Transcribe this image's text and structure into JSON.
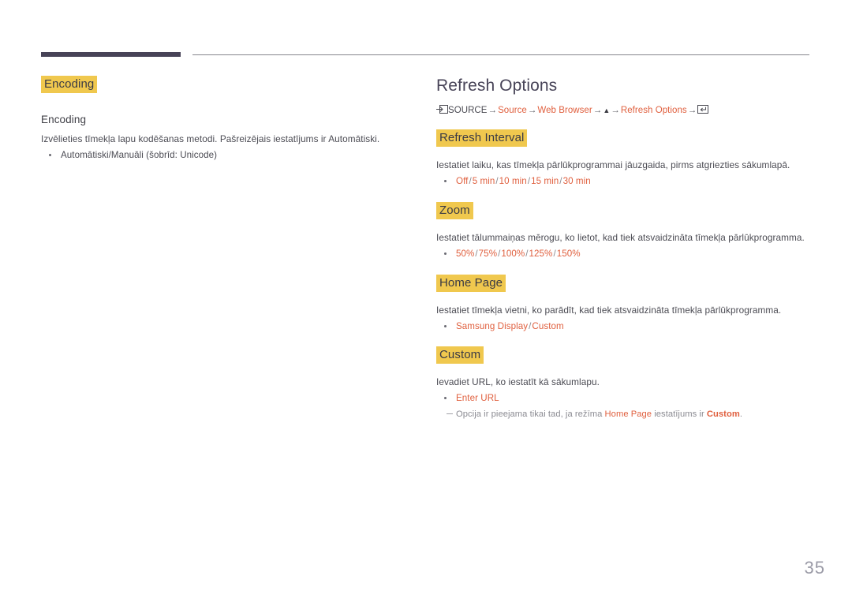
{
  "colors": {
    "highlight": "#f0c84e",
    "accent": "#e0603f",
    "heading": "#474357",
    "body": "#4b4b53",
    "rule_dark": "#474357",
    "rule_light": "#86868c",
    "page_number": "#9a9aa6"
  },
  "left_column": {
    "highlight_heading": "Encoding",
    "sub_heading": "Encoding",
    "description": "Izvēlieties tīmekļa lapu kodēšanas metodi. Pašreizējais iestatījums ir Automātiski.",
    "bullets": [
      {
        "text": "Automātiski/Manuāli (šobrīd: Unicode)",
        "style": "plain"
      }
    ]
  },
  "right_column": {
    "page_heading": "Refresh Options",
    "breadcrumb": {
      "source_icon": "source-input-icon",
      "source_label": "SOURCE",
      "items": [
        {
          "label": "Source",
          "type": "link"
        },
        {
          "label": "Web Browser",
          "type": "link"
        },
        {
          "label": "▲",
          "type": "up-triangle-icon"
        },
        {
          "label": "Refresh Options",
          "type": "link"
        }
      ],
      "arrow": "→",
      "enter_icon": "enter-key-icon"
    },
    "sections": [
      {
        "title": "Refresh Interval",
        "description": "Iestatiet laiku, kas tīmekļa pārlūkprogrammai jāuzgaida, pirms atgriezties sākumlapā.",
        "options": [
          "Off",
          "5 min",
          "10 min",
          "15 min",
          "30 min"
        ],
        "separator": "/"
      },
      {
        "title": "Zoom",
        "description": "Iestatiet tālummaiņas mērogu, ko lietot, kad tiek atsvaidzināta tīmekļa pārlūkprogramma.",
        "options": [
          "50%",
          "75%",
          "100%",
          "125%",
          "150%"
        ],
        "separator": "/"
      },
      {
        "title": "Home Page",
        "description": "Iestatiet tīmekļa vietni, ko parādīt, kad tiek atsvaidzināta tīmekļa pārlūkprogramma.",
        "options": [
          "Samsung Display",
          "Custom"
        ],
        "separator": "/"
      },
      {
        "title": "Custom",
        "description": "Ievadiet URL, ko iestatīt kā sākumlapu.",
        "options": [
          "Enter URL"
        ],
        "separator": "/",
        "footnote": {
          "part1": "Opcija ir pieejama tikai tad, ja režīma ",
          "accent1": "Home Page",
          "part2": " iestatījums ir ",
          "accent2": "Custom",
          "part3": "."
        }
      }
    ]
  },
  "page_number": "35"
}
